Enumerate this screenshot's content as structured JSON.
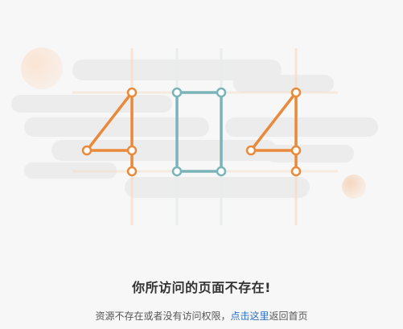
{
  "error_page": {
    "code_digits": [
      "4",
      "0",
      "4"
    ],
    "title": "你所访问的页面不存在!",
    "description_prefix": "资源不存在或者没有访问权限，",
    "link_text": "点击这里",
    "description_suffix": "返回首页"
  },
  "colors": {
    "orange_digit": "#e98a3a",
    "teal_digit": "#7ab3b8",
    "cloud": "#ececec",
    "background": "#f7f7f7",
    "link": "#2e6fbf",
    "title_text": "#333333"
  },
  "icons": {
    "illustration": "404-digits-with-clouds"
  }
}
